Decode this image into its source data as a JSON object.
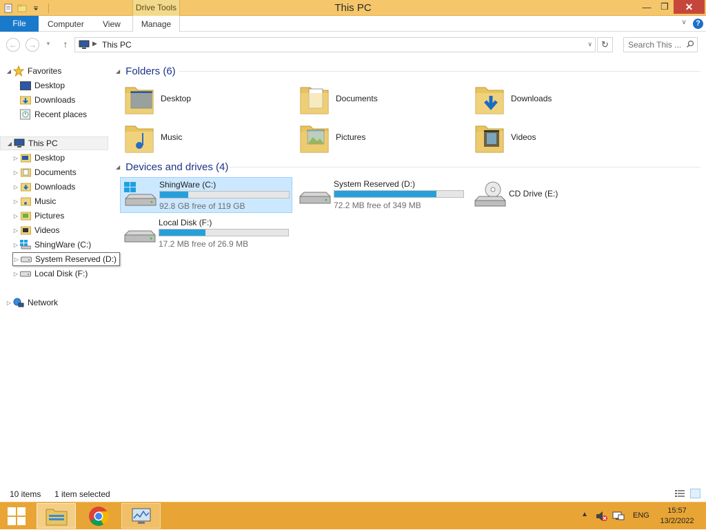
{
  "window": {
    "title": "This PC",
    "contextual_tab": "Drive Tools",
    "minimize_glyph": "—",
    "maximize_glyph": "❐",
    "close_glyph": "✕"
  },
  "ribbon": {
    "tabs": [
      "File",
      "Computer",
      "View",
      "Manage"
    ],
    "help_glyph": "?"
  },
  "address": {
    "path": "This PC",
    "search_placeholder": "Search This ..."
  },
  "nav_pane": {
    "favorites_label": "Favorites",
    "favorites": [
      {
        "label": "Desktop",
        "icon": "desktop-icon"
      },
      {
        "label": "Downloads",
        "icon": "downloads-folder-icon"
      },
      {
        "label": "Recent places",
        "icon": "recent-places-icon"
      }
    ],
    "this_pc_label": "This PC",
    "this_pc_items": [
      {
        "label": "Desktop",
        "icon": "folder-icon"
      },
      {
        "label": "Documents",
        "icon": "folder-icon"
      },
      {
        "label": "Downloads",
        "icon": "folder-icon"
      },
      {
        "label": "Music",
        "icon": "folder-icon"
      },
      {
        "label": "Pictures",
        "icon": "folder-icon"
      },
      {
        "label": "Videos",
        "icon": "folder-icon"
      },
      {
        "label": "ShingWare (C:)",
        "icon": "windows-drive-icon"
      },
      {
        "label": "System Reserved (D:)",
        "icon": "drive-icon"
      },
      {
        "label": "Local Disk (F:)",
        "icon": "drive-icon"
      }
    ],
    "network_label": "Network"
  },
  "content": {
    "folders_header": "Folders (6)",
    "folders": [
      {
        "label": "Desktop",
        "icon": "desktop-folder-icon"
      },
      {
        "label": "Documents",
        "icon": "documents-folder-icon"
      },
      {
        "label": "Downloads",
        "icon": "downloads-folder-icon"
      },
      {
        "label": "Music",
        "icon": "music-folder-icon"
      },
      {
        "label": "Pictures",
        "icon": "pictures-folder-icon"
      },
      {
        "label": "Videos",
        "icon": "videos-folder-icon"
      }
    ],
    "drives_header": "Devices and drives (4)",
    "drives": [
      {
        "name": "ShingWare (C:)",
        "free": "92.8 GB free of 119 GB",
        "used_fraction": 0.22,
        "selected": true
      },
      {
        "name": "System Reserved (D:)",
        "free": "72.2 MB free of 349 MB",
        "used_fraction": 0.79,
        "selected": false
      },
      {
        "name": "CD Drive (E:)",
        "free": "",
        "used_fraction": null,
        "selected": false
      },
      {
        "name": "Local Disk (F:)",
        "free": "17.2 MB free of 26.9 MB",
        "used_fraction": 0.36,
        "selected": false
      }
    ]
  },
  "status": {
    "item_count": "10 items",
    "selected_count": "1 item selected"
  },
  "taskbar": {
    "language": "ENG",
    "time": "15:57",
    "date": "13/2/2022"
  },
  "colors": {
    "titlebar": "#f5c66a",
    "file_tab": "#1979ca",
    "taskbar": "#e8a535",
    "drive_bar": "#26a0da",
    "selection": "#cce8ff",
    "group_header": "#1e3287"
  }
}
